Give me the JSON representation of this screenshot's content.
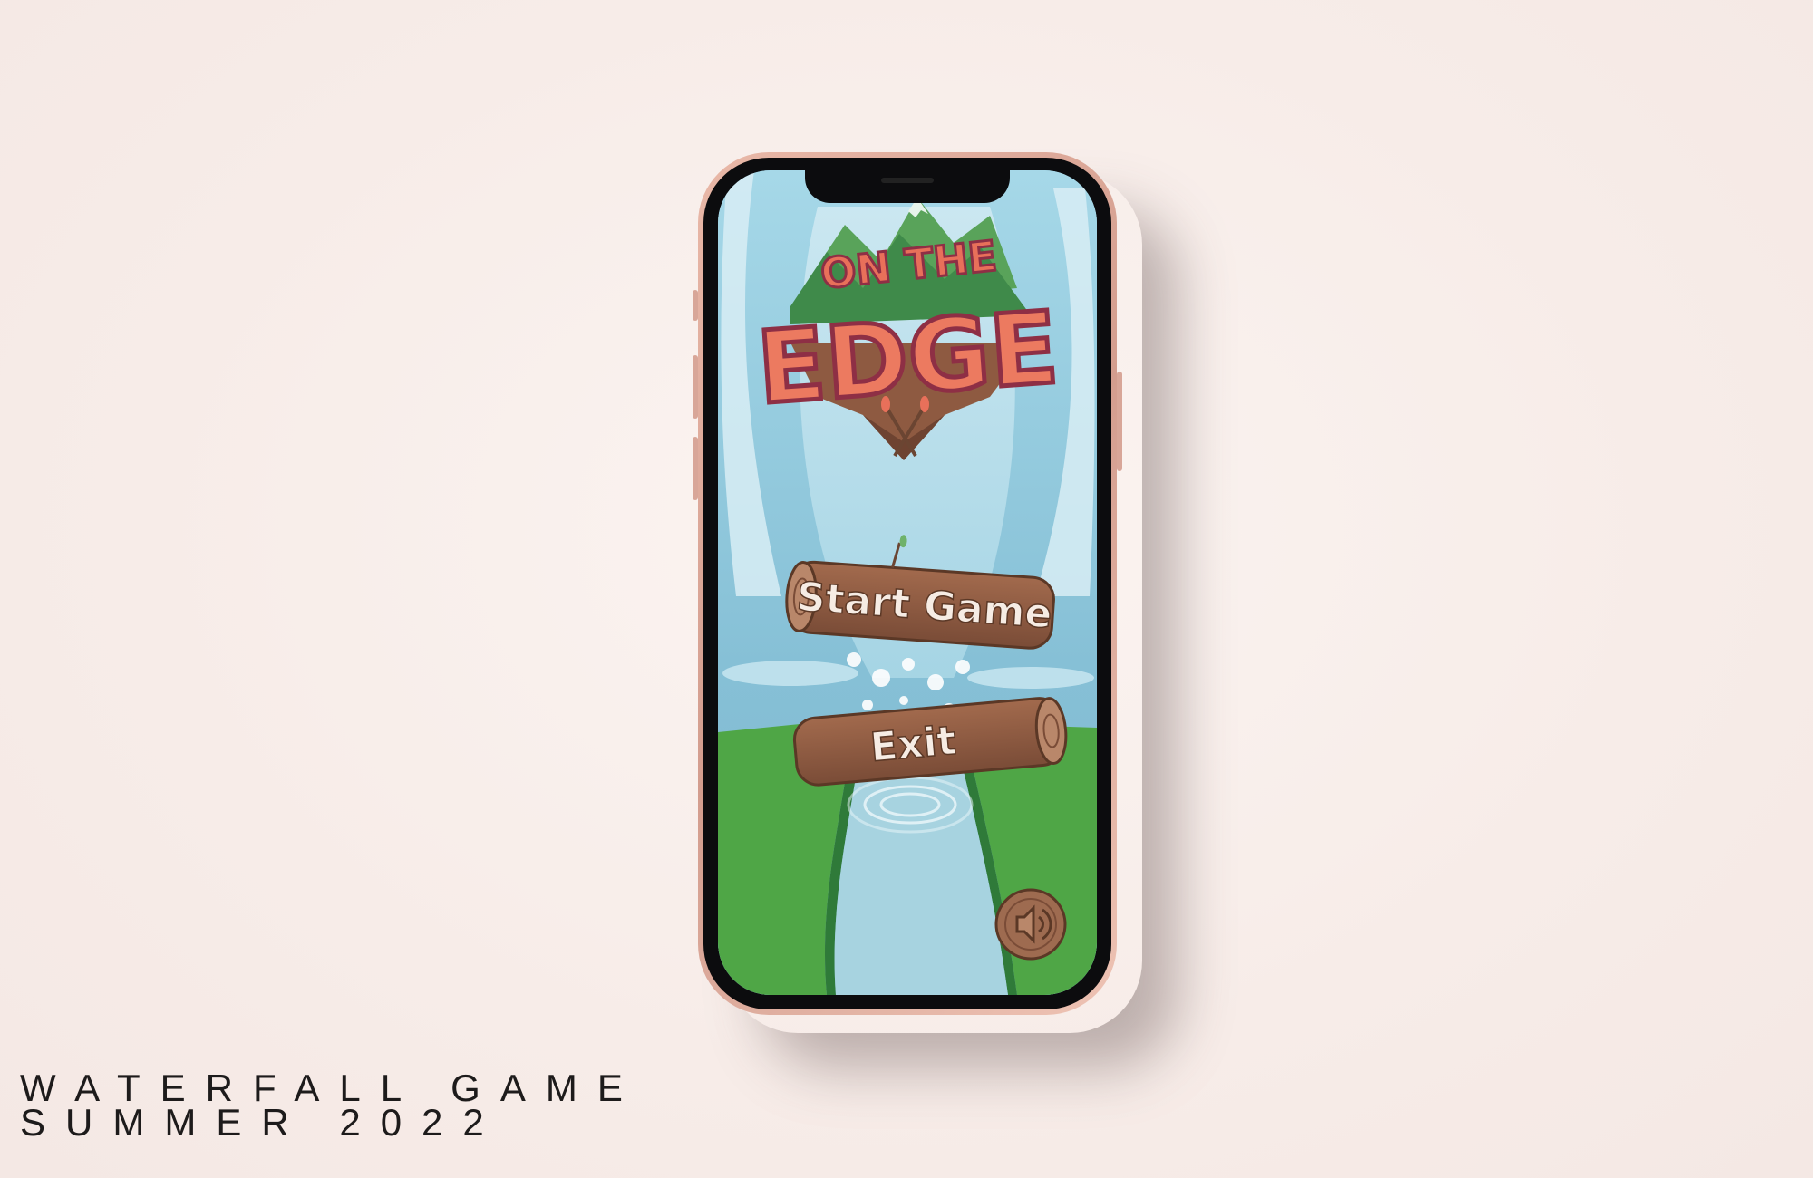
{
  "caption": {
    "line1": "WATERFALL GAME",
    "line2": "SUMMER 2022"
  },
  "game": {
    "logo": {
      "line1": "ON THE",
      "line2": "EDGE"
    },
    "buttons": {
      "start": "Start Game",
      "exit": "Exit"
    },
    "sound_icon": "speaker-icon"
  },
  "colors": {
    "background": "#f8efec",
    "phone_frame": "#e0ae9e",
    "logo_red": "#e8705a",
    "wood": "#8c5a42",
    "grass": "#4ea745",
    "water": "#9fd2e3"
  }
}
